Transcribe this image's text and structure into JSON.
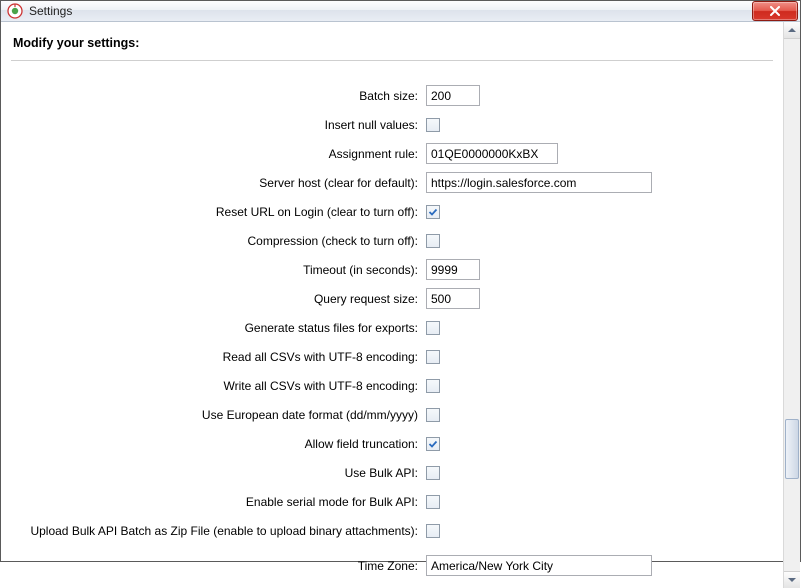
{
  "window": {
    "title": "Settings"
  },
  "heading": "Modify your settings:",
  "fields": {
    "batch_size": {
      "label": "Batch size:",
      "value": "200"
    },
    "insert_null": {
      "label": "Insert null values:",
      "checked": false
    },
    "assignment_rule": {
      "label": "Assignment rule:",
      "value": "01QE0000000KxBX"
    },
    "server_host": {
      "label": "Server host (clear for default):",
      "value": "https://login.salesforce.com"
    },
    "reset_url": {
      "label": "Reset URL on Login (clear to turn off):",
      "checked": true
    },
    "compression": {
      "label": "Compression (check to turn off):",
      "checked": false
    },
    "timeout": {
      "label": "Timeout (in seconds):",
      "value": "9999"
    },
    "query_size": {
      "label": "Query request size:",
      "value": "500"
    },
    "status_files": {
      "label": "Generate status files for exports:",
      "checked": false
    },
    "read_utf8": {
      "label": "Read all CSVs with UTF-8 encoding:",
      "checked": false
    },
    "write_utf8": {
      "label": "Write all CSVs with UTF-8 encoding:",
      "checked": false
    },
    "euro_date": {
      "label": "Use European date format (dd/mm/yyyy)",
      "checked": false
    },
    "truncation": {
      "label": "Allow field truncation:",
      "checked": true
    },
    "bulk_api": {
      "label": "Use Bulk API:",
      "checked": false
    },
    "serial_bulk": {
      "label": "Enable serial mode for Bulk API:",
      "checked": false
    },
    "bulk_zip": {
      "label": "Upload Bulk API Batch as Zip File (enable to upload binary attachments):",
      "checked": false
    },
    "time_zone": {
      "label": "Time Zone:",
      "value": "America/New York City"
    }
  }
}
